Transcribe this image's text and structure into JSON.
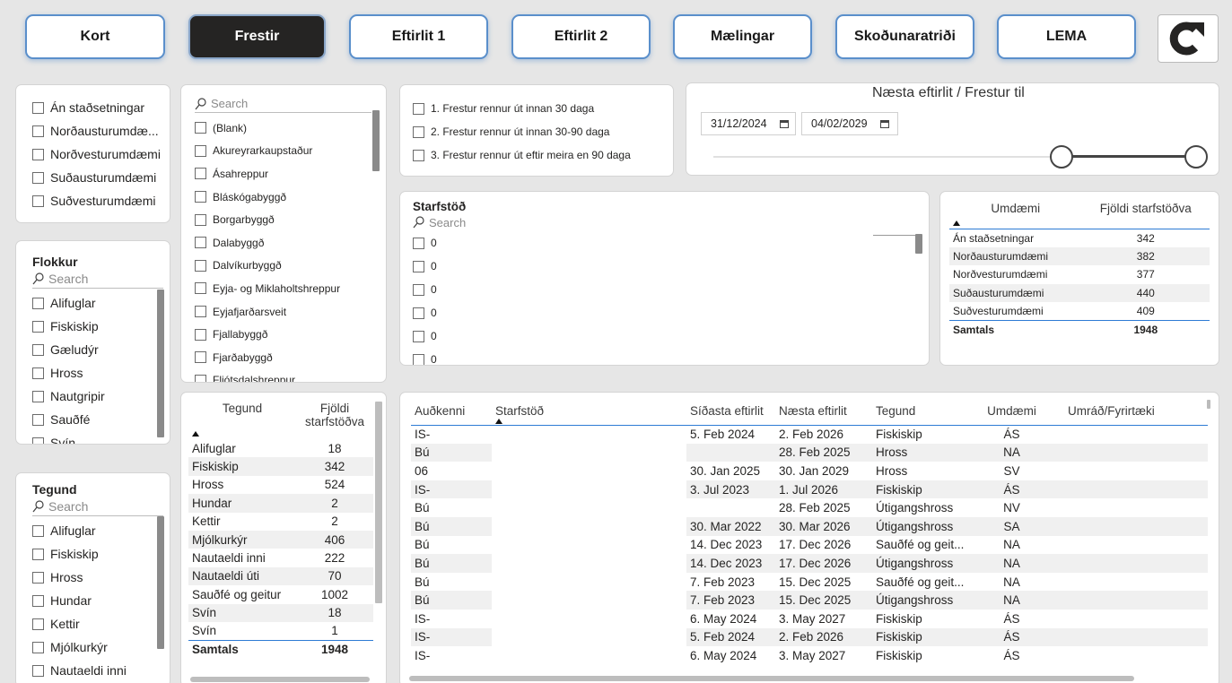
{
  "nav": [
    {
      "label": "Kort",
      "active": false
    },
    {
      "label": "Frestir",
      "active": true
    },
    {
      "label": "Eftirlit 1",
      "active": false
    },
    {
      "label": "Eftirlit 2",
      "active": false
    },
    {
      "label": "Mælingar",
      "active": false
    },
    {
      "label": "Skoðunaratriði",
      "active": false
    },
    {
      "label": "LEMA",
      "active": false
    }
  ],
  "region_slicer": {
    "items": [
      "Án staðsetningar",
      "Norðausturumdæ...",
      "Norðvesturumdæmi",
      "Suðausturumdæmi",
      "Suðvesturumdæmi"
    ]
  },
  "municipality_slicer": {
    "search_placeholder": "Search",
    "items": [
      "(Blank)",
      "Akureyrarkaupstaður",
      "Ásahreppur",
      "Bláskógabyggð",
      "Borgarbyggð",
      "Dalabyggð",
      "Dalvíkurbyggð",
      "Eyja- og Miklaholtshreppur",
      "Eyjafjarðarsveit",
      "Fjallabyggð",
      "Fjarðabyggð",
      "Fljótsdalshreppur"
    ]
  },
  "deadline_slicer": {
    "items": [
      "1. Frestur rennur út innan 30 daga",
      "2. Frestur rennur út innan 30-90 daga",
      "3. Frestur rennur út eftir meira en 90 daga"
    ]
  },
  "date_slicer": {
    "title": "Næsta eftirlit / Frestur til",
    "start": "31/12/2024",
    "end": "04/02/2029"
  },
  "flokkur_slicer": {
    "title": "Flokkur",
    "search_placeholder": "Search",
    "items": [
      "Alifuglar",
      "Fiskiskip",
      "Gæludýr",
      "Hross",
      "Nautgripir",
      "Sauðfé",
      "Svín"
    ]
  },
  "tegund_slicer": {
    "title": "Tegund",
    "search_placeholder": "Search",
    "items": [
      "Alifuglar",
      "Fiskiskip",
      "Hross",
      "Hundar",
      "Kettir",
      "Mjólkurkýr",
      "Nautaeldi inni"
    ]
  },
  "starfstod_slicer": {
    "title": "Starfstöð",
    "search_placeholder": "Search",
    "items": [
      "0",
      "0",
      "0",
      "0",
      "0",
      "0"
    ]
  },
  "region_table": {
    "headers": [
      "Umdæmi",
      "Fjöldi starfstöðva"
    ],
    "rows": [
      [
        "Án staðsetningar",
        "342"
      ],
      [
        "Norðausturumdæmi",
        "382"
      ],
      [
        "Norðvesturumdæmi",
        "377"
      ],
      [
        "Suðausturumdæmi",
        "440"
      ],
      [
        "Suðvesturumdæmi",
        "409"
      ]
    ],
    "total": [
      "Samtals",
      "1948"
    ]
  },
  "type_table": {
    "headers": [
      "Tegund",
      "Fjöldi starfstöðva"
    ],
    "rows": [
      [
        "Alifuglar",
        "18"
      ],
      [
        "Fiskiskip",
        "342"
      ],
      [
        "Hross",
        "524"
      ],
      [
        "Hundar",
        "2"
      ],
      [
        "Kettir",
        "2"
      ],
      [
        "Mjólkurkýr",
        "406"
      ],
      [
        "Nautaeldi inni",
        "222"
      ],
      [
        "Nautaeldi úti",
        "70"
      ],
      [
        "Sauðfé og geitur",
        "1002"
      ],
      [
        "Svín",
        "18"
      ],
      [
        "Svín",
        "1"
      ]
    ],
    "total": [
      "Samtals",
      "1948"
    ]
  },
  "main_table": {
    "headers": [
      "Auðkenni",
      "Starfstöð",
      "Síðasta eftirlit",
      "Næsta eftirlit",
      "Tegund",
      "Umdæmi",
      "Umráð/Fyrirtæki"
    ],
    "rows": [
      [
        "IS-",
        "",
        "5. Feb 2024",
        "2. Feb 2026",
        "Fiskiskip",
        "ÁS",
        ""
      ],
      [
        "Bú",
        "",
        "",
        "28. Feb 2025",
        "Hross",
        "NA",
        ""
      ],
      [
        "06",
        "",
        "30. Jan 2025",
        "30. Jan 2029",
        "Hross",
        "SV",
        ""
      ],
      [
        "IS-",
        "",
        "3. Jul 2023",
        "1. Jul 2026",
        "Fiskiskip",
        "ÁS",
        ""
      ],
      [
        "Bú",
        "",
        "",
        "28. Feb 2025",
        "Útigangshross",
        "NV",
        ""
      ],
      [
        "Bú",
        "",
        "30. Mar 2022",
        "30. Mar 2026",
        "Útigangshross",
        "SA",
        ""
      ],
      [
        "Bú",
        "",
        "14. Dec 2023",
        "17. Dec 2026",
        "Sauðfé og geit...",
        "NA",
        ""
      ],
      [
        "Bú",
        "",
        "14. Dec 2023",
        "17. Dec 2026",
        "Útigangshross",
        "NA",
        ""
      ],
      [
        "Bú",
        "",
        "7. Feb 2023",
        "15. Dec 2025",
        "Sauðfé og geit...",
        "NA",
        ""
      ],
      [
        "Bú",
        "",
        "7. Feb 2023",
        "15. Dec 2025",
        "Útigangshross",
        "NA",
        ""
      ],
      [
        "IS-",
        "",
        "6. May 2024",
        "3. May 2027",
        "Fiskiskip",
        "ÁS",
        ""
      ],
      [
        "IS-",
        "",
        "5. Feb 2024",
        "2. Feb 2026",
        "Fiskiskip",
        "ÁS",
        ""
      ],
      [
        "IS-",
        "",
        "6. May 2024",
        "3. May 2027",
        "Fiskiskip",
        "ÁS",
        ""
      ]
    ]
  }
}
